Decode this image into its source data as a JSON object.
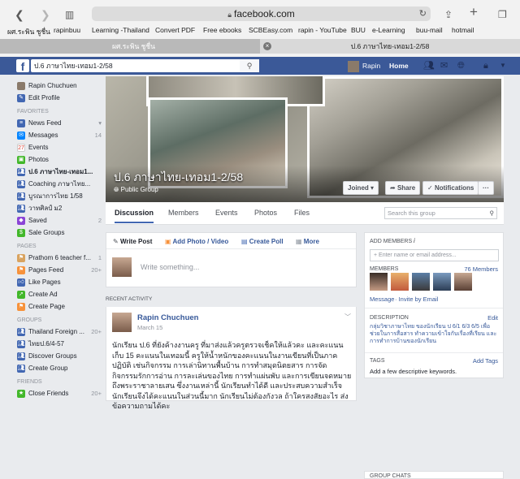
{
  "browser": {
    "url": "facebook.com",
    "bookmarks": [
      "ผศ.ระพิน ชูชื่น",
      "rapinbuu",
      "Learning -Thailand",
      "Convert PDF",
      "Free ebooks",
      "SCBEasy.com",
      "rapin - YouTube",
      "BUU",
      "e-Learning",
      "buu-mail",
      "hotmail"
    ],
    "tabs": [
      "ผศ.ระพิน ชูชื่น",
      "ป.6 ภาษาไทย-เทอม1-2/58"
    ]
  },
  "fb": {
    "search_value": "ป.6 ภาษาไทย-เทอม1-2/58",
    "user": "Rapin",
    "home": "Home"
  },
  "sidebar": {
    "profile": [
      {
        "label": "Rapin Chuchuen"
      },
      {
        "label": "Edit Profile"
      }
    ],
    "favorites_header": "FAVORITES",
    "favorites": [
      {
        "label": "News Feed",
        "count": ""
      },
      {
        "label": "Messages",
        "count": "14"
      },
      {
        "label": "Events",
        "count": ""
      },
      {
        "label": "Photos",
        "count": ""
      },
      {
        "label": "ป.6 ภาษาไทย-เทอม1...",
        "count": ""
      },
      {
        "label": "Coaching ภาษาไทย...",
        "count": ""
      },
      {
        "label": "บูรณาการไทย 1/58",
        "count": ""
      },
      {
        "label": "วาทศิลป์ ม2",
        "count": ""
      },
      {
        "label": "Saved",
        "count": "2"
      },
      {
        "label": "Sale Groups",
        "count": ""
      }
    ],
    "pages_header": "PAGES",
    "pages": [
      {
        "label": "Prathom 6 teacher f...",
        "count": "1"
      },
      {
        "label": "Pages Feed",
        "count": "20+"
      },
      {
        "label": "Like Pages",
        "count": ""
      },
      {
        "label": "Create Ad",
        "count": ""
      },
      {
        "label": "Create Page",
        "count": ""
      }
    ],
    "groups_header": "GROUPS",
    "groups": [
      {
        "label": "Thailand Foreign ...",
        "count": "20+"
      },
      {
        "label": "ไทยป.6/4-57",
        "count": ""
      },
      {
        "label": "Discover Groups",
        "count": ""
      },
      {
        "label": "Create Group",
        "count": ""
      }
    ],
    "friends_header": "FRIENDS",
    "friends": [
      {
        "label": "Close Friends",
        "count": "20+"
      }
    ]
  },
  "group": {
    "title": "ป.6 ภาษาไทย-เทอม1-2/58",
    "type": "Public Group",
    "joined": "Joined ▾",
    "share": "Share",
    "notifications": "Notifications",
    "more": "···",
    "tabs": [
      "Discussion",
      "Members",
      "Events",
      "Photos",
      "Files"
    ],
    "search_placeholder": "Search this group"
  },
  "composer": {
    "write_post": "Write Post",
    "add_photo": "Add Photo / Video",
    "create_poll": "Create Poll",
    "more": "More",
    "placeholder": "Write something..."
  },
  "recent": {
    "header": "RECENT ACTIVITY",
    "author": "Rapin Chuchuen",
    "date": "March 15",
    "body": "นักเรียน ป.6 ที่ยังค้างงานครู ที่มาส่งแล้วครูตรวจเช็คให้แล้วคะ และคะแนนเก็บ 15 คะแนนในเทอมนี้ ครูให้น้ำหนักของคะแนนในงานเขียนที่เป็นภาคปฏิบัติ เช่นกิจกรรม การเล่านิทานพื้นบ้าน การทำสมุดนิตยสาร การจัดกิจกรรมรักการอ่าน การละเล่นของไทย การทำแผ่นพับ และการเขียนจดหมายถึงพระราชาลายเสน ซึ่งงานเหล่านี้ นักเรียนทำได้ดี และประสบความสำเร็จ นักเรียนจึงได้คะแนนในส่วนนี้มาก นักเรียนไม่ต้องกังวล ถ้าใครสงสัยอะไร ส่งข้อความถามได้คะ"
  },
  "right": {
    "add_members": "ADD MEMBERS",
    "add_placeholder": "+ Enter name or email address...",
    "members_label": "MEMBERS",
    "members_count": "76 Members",
    "message": "Message",
    "invite": "· Invite by Email",
    "description_label": "DESCRIPTION",
    "edit": "Edit",
    "description": "กลุ่มวิชาภาษาไทย ของนักเรียน ป 6/1 6/3 6/5 เพื่อช่วยในการสื่อสาร ทำความเข้าใจกับเรื่องที่เรียน และการทำการบ้านของนักเรียน",
    "tags_label": "TAGS",
    "add_tags": "Add Tags",
    "tags_hint": "Add a few descriptive keywords.",
    "group_chats": "GROUP CHATS"
  }
}
